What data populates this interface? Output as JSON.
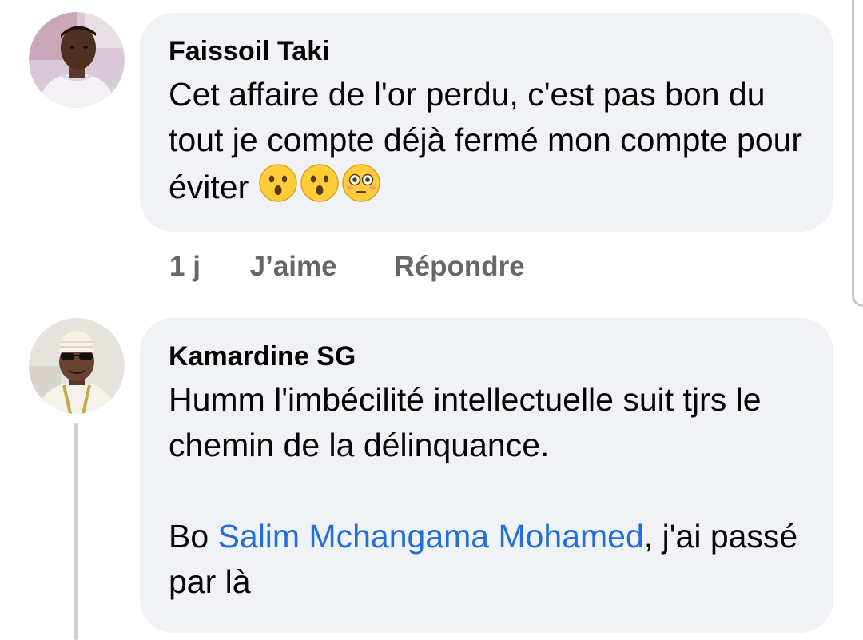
{
  "comments": [
    {
      "author": "Faissoil Taki",
      "text": "Cet affaire de l'or perdu, c'est pas bon du tout je compte déjà fermé mon compte pour éviter",
      "emojis": [
        "hushed-face-emoji",
        "hushed-face-emoji",
        "flushed-face-emoji"
      ],
      "time": "1 j",
      "like_label": "J’aime",
      "reply_label": "Répondre"
    },
    {
      "author": "Kamardine SG",
      "text_line": "Humm l'imbécilité intellectuelle suit tjrs le chemin de la délinquance.",
      "text_prefix": "Bo ",
      "mention": "Salim Mchangama Mohamed",
      "text_suffix": ", j'ai passé par là"
    }
  ],
  "colors": {
    "bubble": "#f0f2f5",
    "mention": "#216fdb",
    "meta": "#65676b"
  }
}
